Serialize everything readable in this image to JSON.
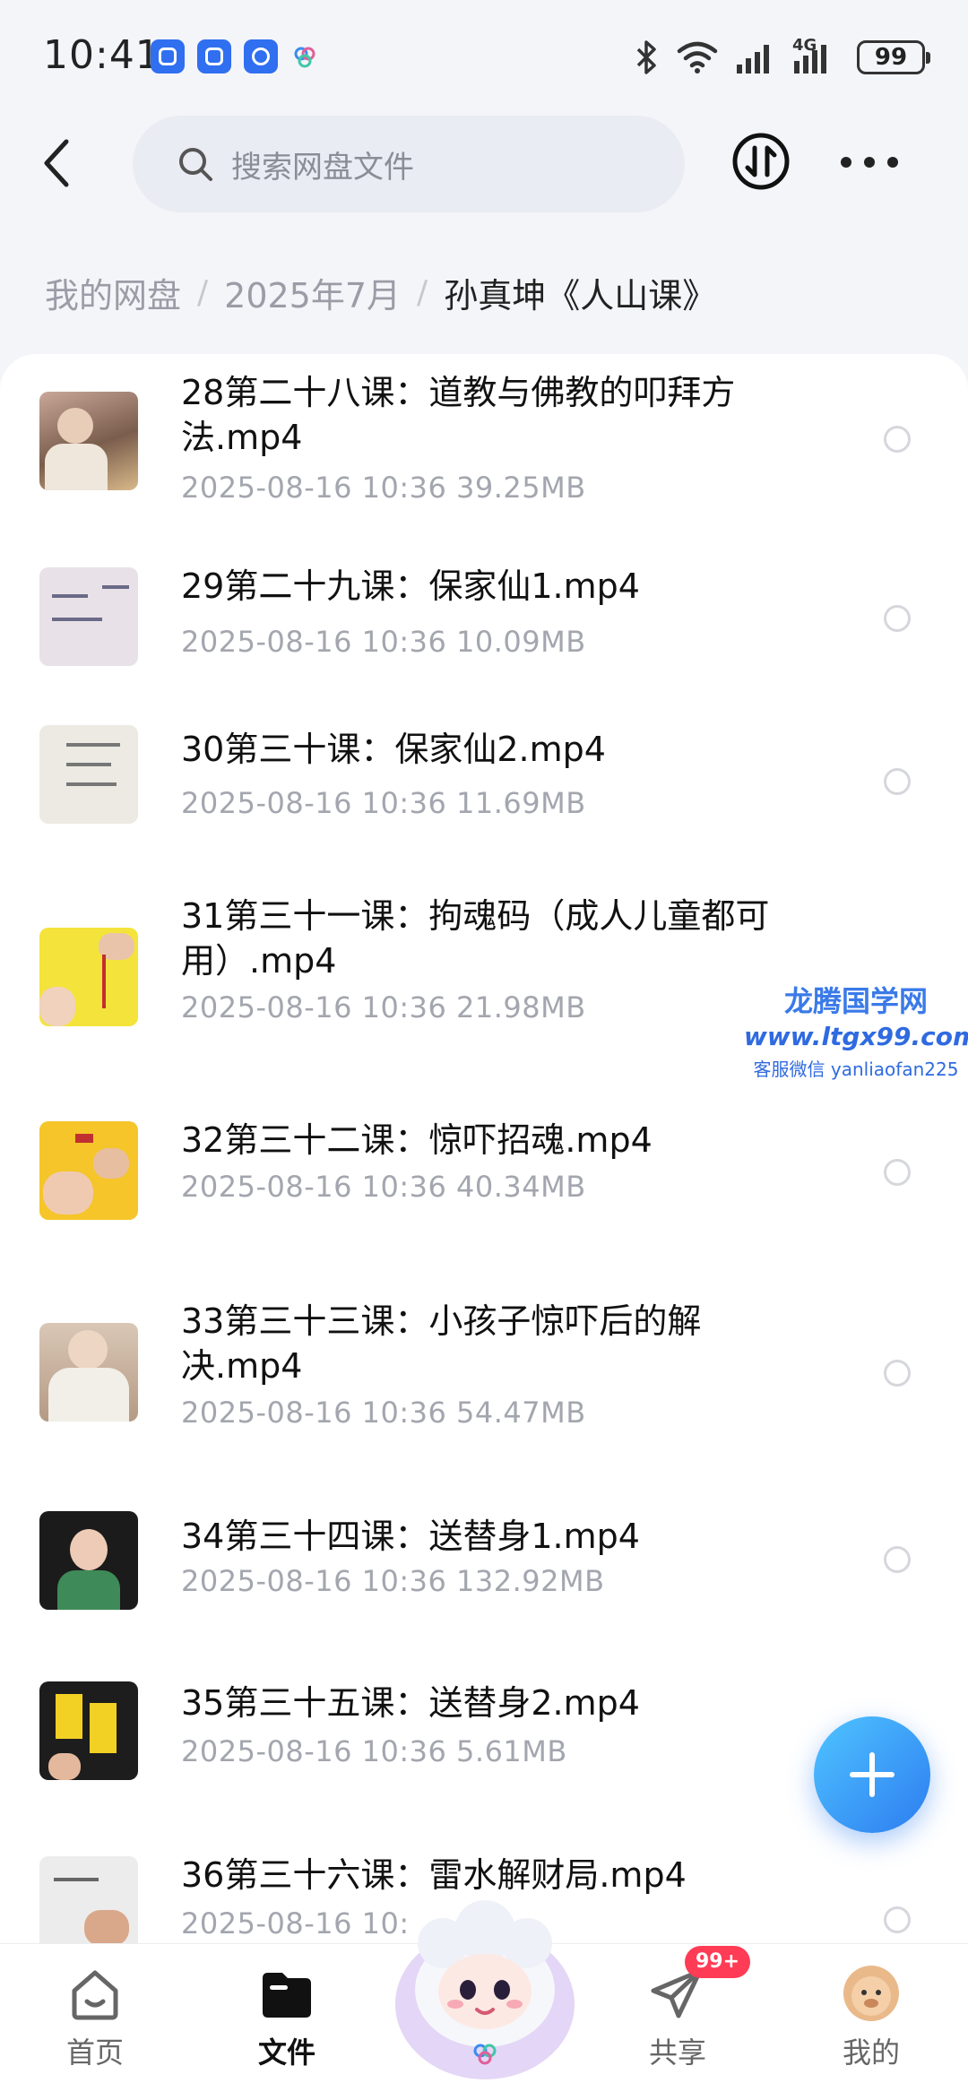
{
  "status_bar": {
    "time": "10:41",
    "network": "4G",
    "battery": "99"
  },
  "header": {
    "search_placeholder": "搜索网盘文件"
  },
  "breadcrumb": {
    "items": [
      "我的网盘",
      "2025年7月",
      "孙真坤《人山课》"
    ]
  },
  "files": [
    {
      "line1": "28第二十八课：道教与佛教的叩拜方",
      "line2": "法.mp4",
      "meta": "2025-08-16  10:36  39.25MB"
    },
    {
      "line1": "29第二十九课：保家仙1.mp4",
      "line2": "",
      "meta": "2025-08-16  10:36  10.09MB"
    },
    {
      "line1": "30第三十课：保家仙2.mp4",
      "line2": "",
      "meta": "2025-08-16  10:36  11.69MB"
    },
    {
      "line1": "31第三十一课：拘魂码（成人儿童都可",
      "line2": "用）.mp4",
      "meta": "2025-08-16  10:36  21.98MB"
    },
    {
      "line1": "32第三十二课：惊吓招魂.mp4",
      "line2": "",
      "meta": "2025-08-16  10:36  40.34MB"
    },
    {
      "line1": "33第三十三课：小孩子惊吓后的解",
      "line2": "决.mp4",
      "meta": "2025-08-16  10:36  54.47MB"
    },
    {
      "line1": "34第三十四课：送替身1.mp4",
      "line2": "",
      "meta": "2025-08-16  10:36  132.92MB"
    },
    {
      "line1": "35第三十五课：送替身2.mp4",
      "line2": "",
      "meta": "2025-08-16  10:36  5.61MB"
    },
    {
      "line1": "36第三十六课：雷水解财局.mp4",
      "line2": "",
      "meta": "2025-08-16  10:"
    }
  ],
  "watermark": {
    "title": "龙腾国学网",
    "url": "www.ltgx99.com",
    "sub": "客服微信 yanliaofan225"
  },
  "bottom_nav": {
    "home": "首页",
    "files": "文件",
    "share": "共享",
    "share_badge": "99+",
    "me": "我的"
  },
  "colors": {
    "accent": "#2d7df0",
    "badge": "#ff3b55"
  }
}
